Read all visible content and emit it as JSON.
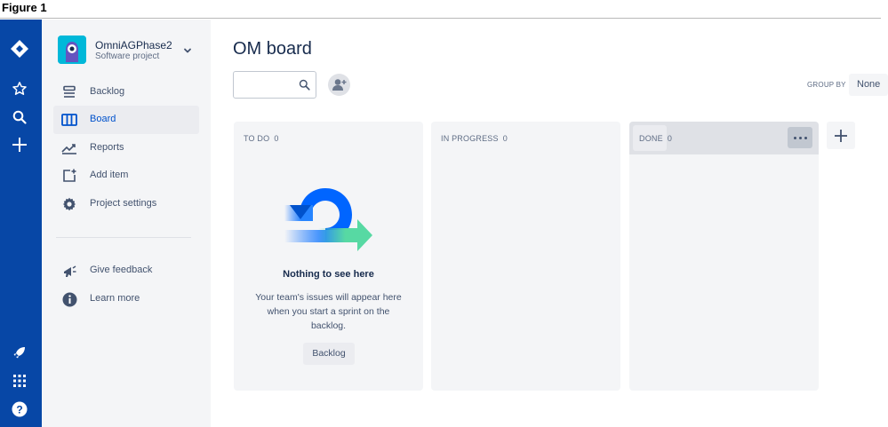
{
  "figure": {
    "label": "Figure 1"
  },
  "global_nav": {
    "icons": [
      "jira-logo-icon",
      "star-icon",
      "search-icon",
      "plus-icon",
      "rocket-icon",
      "app-switcher-icon",
      "help-icon"
    ],
    "accent": "#0747a6"
  },
  "project": {
    "name": "OmniAGPhase2",
    "type": "Software project"
  },
  "sidebar": {
    "items": [
      {
        "label": "Backlog",
        "icon": "backlog-icon",
        "selected": false
      },
      {
        "label": "Board",
        "icon": "board-icon",
        "selected": true
      },
      {
        "label": "Reports",
        "icon": "reports-icon",
        "selected": false
      },
      {
        "label": "Add item",
        "icon": "add-item-icon",
        "selected": false
      },
      {
        "label": "Project settings",
        "icon": "gear-icon",
        "selected": false
      }
    ],
    "footer_items": [
      {
        "label": "Give feedback",
        "icon": "megaphone-icon"
      },
      {
        "label": "Learn more",
        "icon": "info-icon"
      }
    ]
  },
  "board": {
    "title": "OM board",
    "search": {
      "value": "",
      "placeholder": ""
    },
    "group_by": {
      "label": "GROUP BY",
      "value": "None"
    },
    "columns": [
      {
        "title": "TO DO",
        "count": "0"
      },
      {
        "title": "IN PROGRESS",
        "count": "0"
      },
      {
        "title": "DONE",
        "count": "0"
      }
    ],
    "empty_state": {
      "title": "Nothing to see here",
      "description": "Your team's issues will appear here when you start a sprint on the backlog.",
      "button_label": "Backlog"
    }
  },
  "colors": {
    "selected_text": "#0052cc",
    "column_bg": "#f4f5f7",
    "illustration_blue": "#0065ff",
    "illustration_green": "#57d9a3"
  }
}
